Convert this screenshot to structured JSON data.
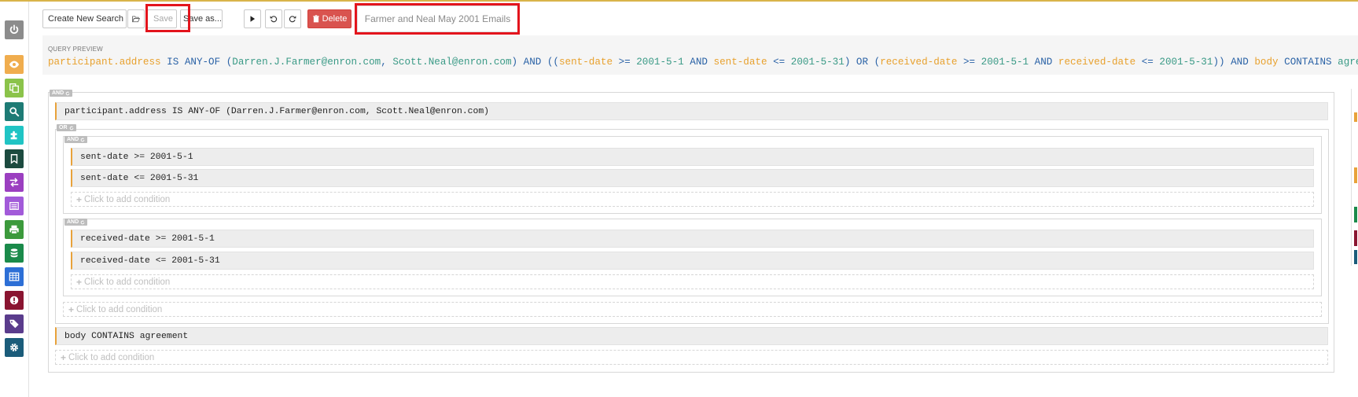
{
  "toolbar": {
    "create_new_search": "Create New Search",
    "save": "Save",
    "save_as": "Save as...",
    "delete": "Delete"
  },
  "search_title": "Farmer and Neal May 2001 Emails",
  "query_preview": {
    "label": "QUERY PREVIEW",
    "tokens": {
      "t1": "participant.address",
      "t2": " IS ANY-OF (",
      "t3": "Darren.J.Farmer@enron.com",
      "t4": ", ",
      "t5": "Scott.Neal@enron.com",
      "t6": ") AND ((",
      "t7": "sent-date",
      "t8": " >= ",
      "t9": "2001-5-1",
      "t10": " AND ",
      "t11": "sent-date",
      "t12": " <= ",
      "t13": "2001-5-31",
      "t14": ") OR (",
      "t15": "received-date",
      "t16": " >= ",
      "t17": "2001-5-1",
      "t18": " AND ",
      "t19": "received-date",
      "t20": " <= ",
      "t21": "2001-5-31",
      "t22": ")) AND ",
      "t23": "body",
      "t24": " CONTAINS ",
      "t25": "agreement"
    }
  },
  "builder": {
    "root_operator": "AND",
    "or_operator": "OR",
    "and_sent_operator": "AND",
    "and_received_operator": "AND",
    "participant_condition": "participant.address IS ANY-OF (Darren.J.Farmer@enron.com, Scott.Neal@enron.com)",
    "sent_conditions": [
      "sent-date >= 2001-5-1",
      "sent-date <= 2001-5-31"
    ],
    "received_conditions": [
      "received-date >= 2001-5-1",
      "received-date <= 2001-5-31"
    ],
    "body_condition": "body CONTAINS agreement",
    "add_condition_label": "Click to add condition"
  },
  "sidebar_items": [
    {
      "icon": "power-icon",
      "color": "#8c8c8c"
    },
    {
      "icon": "eye-icon",
      "color": "#f0ad4e"
    },
    {
      "icon": "copy-icon",
      "color": "#8bc34a"
    },
    {
      "icon": "search-icon",
      "color": "#1e7b75"
    },
    {
      "icon": "puzzle-icon",
      "color": "#20c4c4"
    },
    {
      "icon": "bookmark-icon",
      "color": "#1c4a3f"
    },
    {
      "icon": "exchange-icon",
      "color": "#9b3fc0"
    },
    {
      "icon": "list-icon",
      "color": "#a25ad9"
    },
    {
      "icon": "print-icon",
      "color": "#3c9a3c"
    },
    {
      "icon": "database-icon",
      "color": "#1a8a4a"
    },
    {
      "icon": "table-icon",
      "color": "#2d6fd6"
    },
    {
      "icon": "alert-icon",
      "color": "#8a1531"
    },
    {
      "icon": "tags-icon",
      "color": "#5a3c8c"
    },
    {
      "icon": "gear-icon",
      "color": "#1b5c7a"
    }
  ],
  "colors": {
    "accent_orange": "#e8a23a",
    "keyword_blue": "#2a62a6",
    "value_teal": "#3a9a86",
    "delete_red": "#d9534f",
    "highlight_red": "#e3141c"
  }
}
